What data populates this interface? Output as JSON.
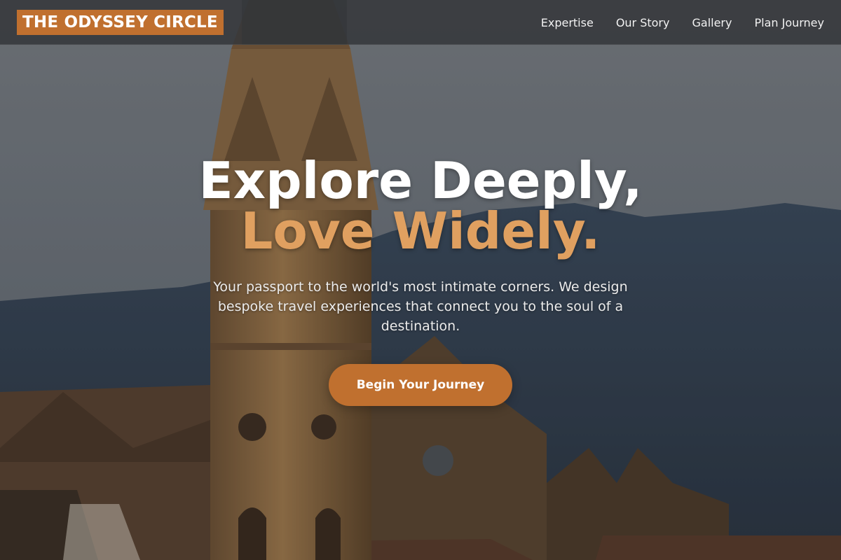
{
  "brand": {
    "logo_text": "THE ODYSSEY CIRCLE",
    "accent_color": "#c0702f",
    "highlight_color": "#e0a060"
  },
  "nav": {
    "items": [
      {
        "label": "Expertise"
      },
      {
        "label": "Our Story"
      },
      {
        "label": "Gallery"
      },
      {
        "label": "Plan Journey"
      }
    ]
  },
  "hero": {
    "title_line1": "Explore Deeply,",
    "title_line2": "Love Widely.",
    "subtitle": "Your passport to the world's most intimate corners. We design bespoke travel experiences that connect you to the soul of a destination.",
    "cta_label": "Begin Your Journey",
    "background_image": "church-bell-tower-with-hills"
  }
}
